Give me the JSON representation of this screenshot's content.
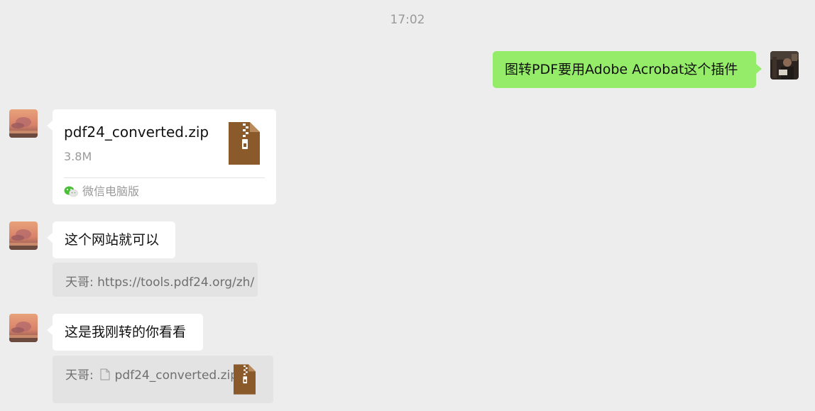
{
  "chat": {
    "timestamp": "17:02",
    "messages": [
      {
        "sender": "me",
        "text": "图转PDF要用Adobe Acrobat这个插件"
      },
      {
        "sender": "other",
        "type": "file",
        "file_name": "pdf24_converted.zip",
        "file_size": "3.8M",
        "source": "微信电脑版"
      },
      {
        "sender": "other",
        "text": "这个网站就可以",
        "quote": {
          "author": "天哥:",
          "text": "https://tools.pdf24.org/zh/"
        }
      },
      {
        "sender": "other",
        "text": "这是我刚转的你看看",
        "quote": {
          "author": "天哥:",
          "file_name": "pdf24_converted.zip"
        }
      }
    ]
  },
  "icons": {
    "file_type": "zip-file-icon",
    "source_app": "wechat-icon",
    "quote_file": "document-icon"
  },
  "colors": {
    "background": "#ededed",
    "my_bubble": "#95ec69",
    "other_bubble": "#ffffff",
    "quote_bg": "#e3e3e3",
    "zip_brown": "#8b5a2b"
  }
}
